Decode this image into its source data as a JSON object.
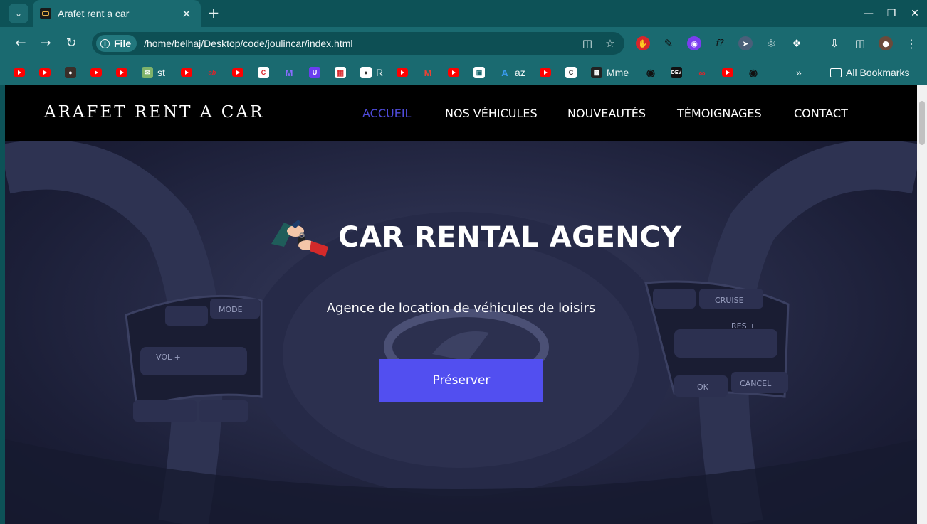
{
  "browser": {
    "tab_title": "Arafet rent a car",
    "address_chip": "File",
    "url": "/home/belhaj/Desktop/code/joulincar/index.html",
    "bookmarks": [
      {
        "icon": "youtube-icon",
        "label": ""
      },
      {
        "icon": "youtube-icon",
        "label": ""
      },
      {
        "icon": "profile-icon",
        "label": ""
      },
      {
        "icon": "youtube-icon",
        "label": ""
      },
      {
        "icon": "youtube-icon",
        "label": ""
      },
      {
        "icon": "mail-card-icon",
        "label": "st"
      },
      {
        "icon": "youtube-icon",
        "label": ""
      },
      {
        "icon": "red-logo-icon",
        "label": ""
      },
      {
        "icon": "youtube-icon",
        "label": ""
      },
      {
        "icon": "c-logo-icon",
        "label": ""
      },
      {
        "icon": "purple-m-icon",
        "label": ""
      },
      {
        "icon": "u-icon",
        "label": ""
      },
      {
        "icon": "grid-icon",
        "label": ""
      },
      {
        "icon": "r-icon",
        "label": "R"
      },
      {
        "icon": "youtube-icon",
        "label": ""
      },
      {
        "icon": "gmail-icon",
        "label": ""
      },
      {
        "icon": "youtube-icon",
        "label": ""
      },
      {
        "icon": "frame-icon",
        "label": ""
      },
      {
        "icon": "azure-icon",
        "label": "az"
      },
      {
        "icon": "youtube-icon",
        "label": ""
      },
      {
        "icon": "c-white-icon",
        "label": ""
      },
      {
        "icon": "dark-square-icon",
        "label": "Mme"
      },
      {
        "icon": "github-icon",
        "label": ""
      },
      {
        "icon": "dev-icon",
        "label": ""
      },
      {
        "icon": "red-swirl-icon",
        "label": ""
      },
      {
        "icon": "youtube-icon",
        "label": ""
      },
      {
        "icon": "github-icon",
        "label": ""
      }
    ],
    "all_bookmarks": "All Bookmarks"
  },
  "site": {
    "brand": "ARAFET RENT A CAR",
    "nav": [
      "ACCUEIL",
      "NOS VÉHICULES",
      "NOUVEAUTÉS",
      "TÉMOIGNAGES",
      "CONTACT"
    ],
    "active_nav": "ACCUEIL",
    "hero_title": "CAR RENTAL AGENCY",
    "hero_subtitle": "Agence de location de véhicules de loisirs",
    "cta_label": "Préserver",
    "wheel_buttons": {
      "mode": "MODE",
      "vol": "VOL +",
      "cruise": "CRUISE",
      "res": "RES +",
      "ok": "OK",
      "cancel": "CANCEL"
    }
  },
  "colors": {
    "chrome": "#0d5257",
    "toolbar": "#1a6a70",
    "nav_bg": "#000000",
    "accent": "#524ff0",
    "active_link": "#4f4bdb"
  }
}
